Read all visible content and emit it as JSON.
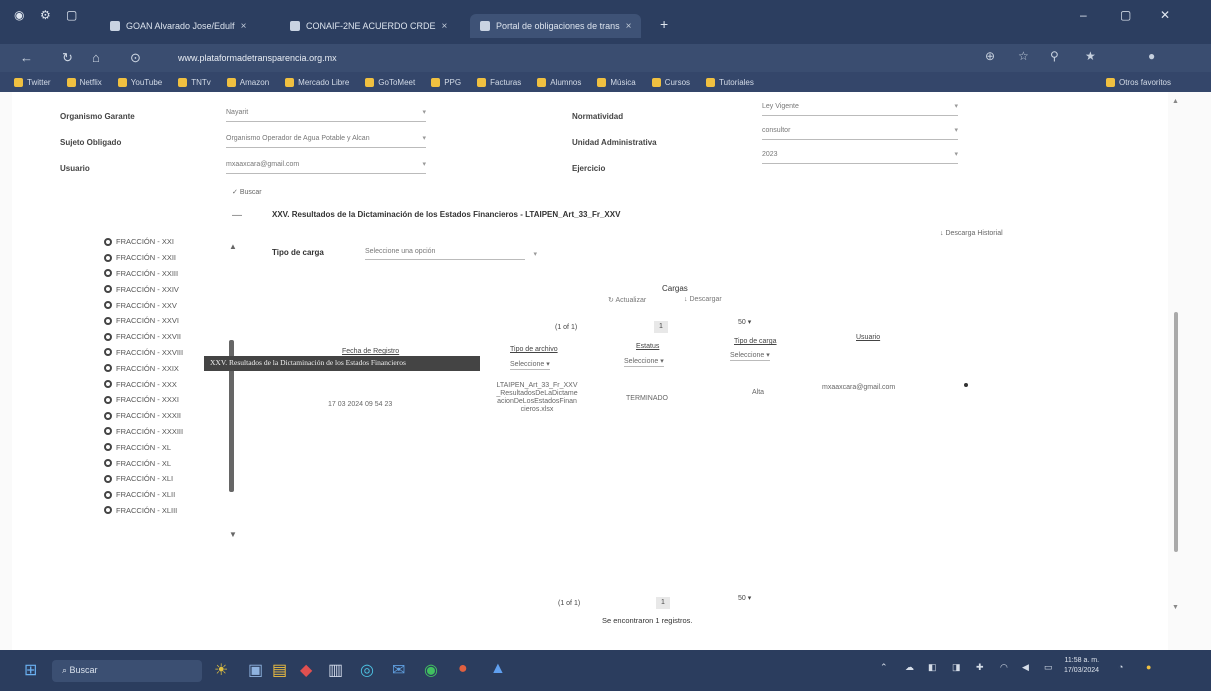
{
  "browser": {
    "tabs": [
      {
        "title": "GOAN Alvarado Jose/Edulf"
      },
      {
        "title": "CONAIF-2NE ACUERDO CRDE"
      },
      {
        "title": "Portal de obligaciones de trans"
      }
    ],
    "new_tab_label": "+",
    "url": "www.plataformadetransparencia.org.mx",
    "bookmarks": [
      "Twitter",
      "Netflix",
      "YouTube",
      "TNTv",
      "Amazon",
      "Mercado Libre",
      "GoToMeet",
      "PPG",
      "Facturas",
      "Alumnos",
      "Música",
      "Cursos",
      "Tutoriales"
    ],
    "bookmarks_other": "Otros favoritos"
  },
  "form": {
    "organismo_label": "Organismo Garante",
    "organismo_value": "Nayarit",
    "sujeto_label": "Sujeto Obligado",
    "sujeto_value": "Organismo Operador de Agua Potable y Alcan",
    "usuario_label": "Usuario",
    "usuario_value": "mxaaxcara@gmail.com",
    "normatividad_label": "Normatividad",
    "normatividad_value": "Ley Vigente",
    "unidad_label": "Unidad Administrativa",
    "unidad_value": "consultor",
    "ejercicio_label": "Ejercicio",
    "ejercicio_value": "2023",
    "buscar_label": "Buscar"
  },
  "section": {
    "minus": "—",
    "title": "XXV. Resultados de la Dictaminación de los Estados Financieros - LTAIPEN_Art_33_Fr_XXV"
  },
  "fracciones": [
    "FRACCIÓN - XXI",
    "FRACCIÓN - XXII",
    "FRACCIÓN - XXIII",
    "FRACCIÓN - XXIV",
    "FRACCIÓN - XXV",
    "FRACCIÓN - XXVI",
    "FRACCIÓN - XXVII",
    "FRACCIÓN - XXVIII",
    "FRACCIÓN - XXIX",
    "FRACCIÓN - XXX",
    "FRACCIÓN - XXXI",
    "FRACCIÓN - XXXII",
    "FRACCIÓN - XXXIII",
    "FRACCIÓN - XL",
    "FRACCIÓN - XL",
    "FRACCIÓN - XLI",
    "FRACCIÓN - XLII",
    "FRACCIÓN - XLIII"
  ],
  "tooltip": "XXV. Resultados de la Dictaminación de los Estados Financieros",
  "tipo_carga": {
    "label": "Tipo de carga",
    "placeholder": "Seleccione una opción"
  },
  "descarga_historial": "Descarga Historial",
  "cargas": {
    "title": "Cargas",
    "actualizar": "Actualizar",
    "descargar": "Descargar",
    "pager_top": "(1 of 1)",
    "page_num": "1",
    "rows_per_page": "50",
    "headers": {
      "fecha": "Fecha de Registro",
      "tipo_archivo": "Tipo de archivo",
      "estatus": "Estatus",
      "tipo_carga": "Tipo de carga",
      "usuario": "Usuario"
    },
    "filter_placeholder": "Seleccione",
    "rows": [
      {
        "fecha": "17 03 2024 09 54 23",
        "archivo_l1": "LTAIPEN_Art_33_Fr_XXV",
        "archivo_l2": "_ResultadosDeLaDictame",
        "archivo_l3": "acionDeLosEstadosFinan",
        "archivo_l4": "cieros.xlsx",
        "estatus": "TERMINADO",
        "tipo": "Alta",
        "usuario": "mxaaxcara@gmail.com"
      }
    ],
    "pager_bottom": "(1 of 1)",
    "footer": "Se encontraron 1 registros."
  },
  "taskbar": {
    "search_label": "Buscar",
    "time": "11:58 a. m.",
    "date": "17/03/2024"
  }
}
